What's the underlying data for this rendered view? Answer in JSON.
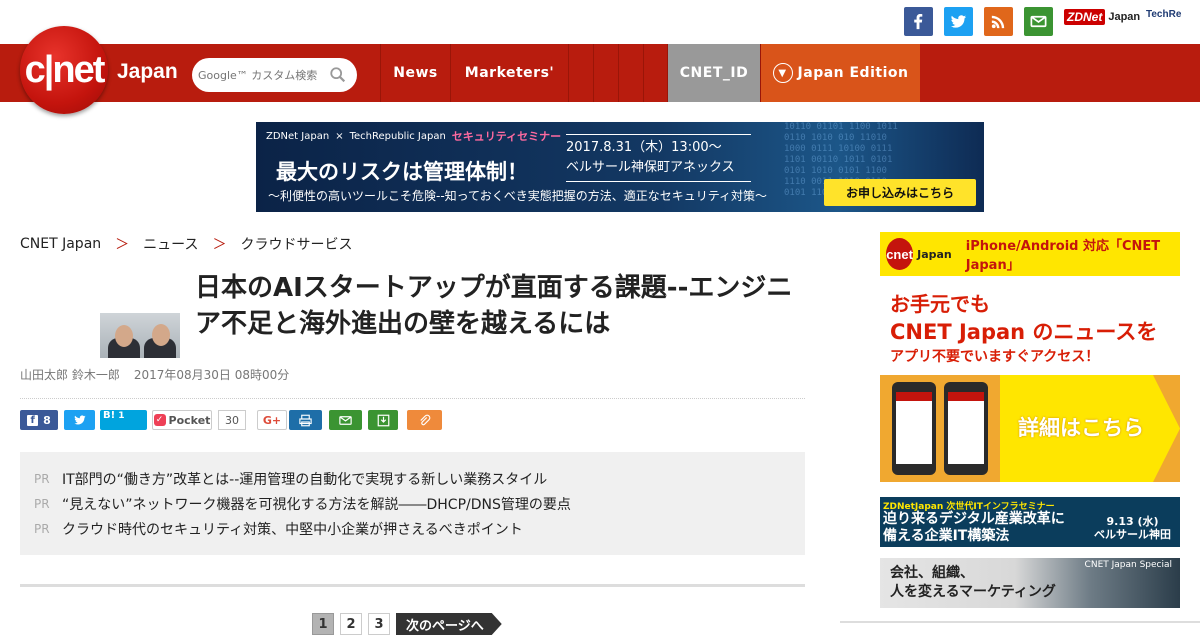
{
  "header": {
    "logo_text": "c|net",
    "logo_suffix": "Japan",
    "search_placeholder": "Google™ カスタム検索",
    "nav": [
      "News",
      "Marketers'"
    ],
    "cnet_id": "CNET_ID",
    "japan_edition": "Japan Edition",
    "zdnet": "ZDNet",
    "zdnet_suffix": "Japan",
    "techrepublic": "TechRe"
  },
  "social_icons": [
    "facebook-icon",
    "twitter-icon",
    "rss-icon",
    "mail-icon"
  ],
  "banner": {
    "top_zd": "ZDNet Japan",
    "top_x": "×",
    "top_tr": "TechRepublic Japan",
    "top_seminar": "セキュリティセミナー",
    "date_line1": "2017.8.31（木）13:00〜",
    "date_line2": "ベルサール神保町アネックス",
    "headline": "最大のリスクは管理体制！",
    "subline": "〜利便性の高いツールこそ危険--知っておくべき実態把握の方法、適正なセキュリティ対策〜",
    "cta": "お申し込みはこちら"
  },
  "breadcrumb": [
    "CNET Japan",
    "＞",
    "ニュース",
    "＞",
    "クラウドサービス"
  ],
  "article": {
    "title": "日本のAIスタートアップが直面する課題--エンジニア不足と海外進出の壁を越えるには",
    "author": "山田太郎 鈴木一郎",
    "date": "2017年08月30日 08時00分"
  },
  "share": {
    "facebook_count": "8",
    "hatena_count": "1",
    "pocket_label": "Pocket",
    "pocket_count": "30",
    "gplus_label": "G+"
  },
  "pr": {
    "tag": "PR",
    "items": [
      "IT部門の“働き方”改革とは--運用管理の自動化で実現する新しい業務スタイル",
      "“見えない”ネットワーク機器を可視化する方法を解説――DHCP/DNS管理の要点",
      "クラウド時代のセキュリティ対策、中堅中小企業が押さえるべきポイント"
    ]
  },
  "pager": {
    "pages": [
      "1",
      "2",
      "3"
    ],
    "next": "次のページへ"
  },
  "sidebar": {
    "ad1": {
      "logo": "cnet",
      "jp": "Japan",
      "head": "iPhone/Android 対応「CNET Japan」",
      "line1": "お手元でも",
      "line2": "CNET Japan のニュースを",
      "line3": "アプリ不要でいますぐアクセス！",
      "cta": "詳細はこちら"
    },
    "ad2": {
      "label": "ZDNetJapan 次世代ITインフラセミナー",
      "line1": "迫り来るデジタル産業改革に",
      "line2": "備える企業IT構築法",
      "date": "9.13 (水)",
      "venue": "ベルサール神田"
    },
    "ad3": {
      "label": "CNET Japan Special",
      "line1": "会社、組織、",
      "line2": "人を変えるマーケティング"
    }
  },
  "colors": {
    "brand_red": "#b81c0e",
    "cnet_id_bg": "#999999",
    "japan_edition_bg": "#d9541a"
  }
}
